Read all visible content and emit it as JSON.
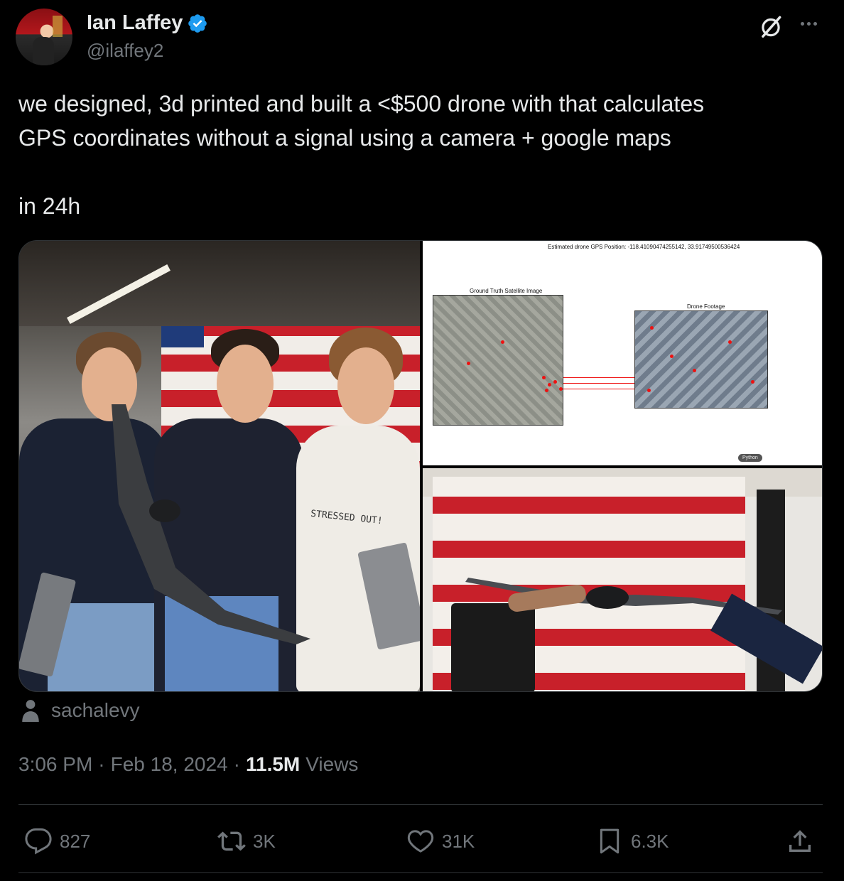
{
  "author": {
    "display_name": "Ian Laffey",
    "handle": "@ilaffey2",
    "verified": true
  },
  "tweet": {
    "text": "we designed, 3d printed and built a <$500 drone with that calculates\nGPS coordinates without a signal using a camera + google maps\n\nin 24h"
  },
  "media": {
    "photo_left": {
      "shirt_text": "STRESSED OUT!"
    },
    "plot": {
      "header": "Estimated drone GPS Position: -118.41090474255142, 33.91749500536424",
      "left_title": "Ground Truth Satellite Image",
      "right_title": "Drone Footage",
      "badge": "Python"
    }
  },
  "photo_credit": {
    "name": "sachalevy"
  },
  "meta": {
    "time": "3:06 PM",
    "date": "Feb 18, 2024",
    "views_count": "11.5M",
    "views_label": "Views"
  },
  "actions": {
    "replies": "827",
    "reposts": "3K",
    "likes": "31K",
    "bookmarks": "6.3K"
  },
  "colors": {
    "background": "#000000",
    "text": "#e7e9ea",
    "secondary": "#71767b",
    "verified": "#1d9bf0",
    "divider": "#2f3336"
  }
}
